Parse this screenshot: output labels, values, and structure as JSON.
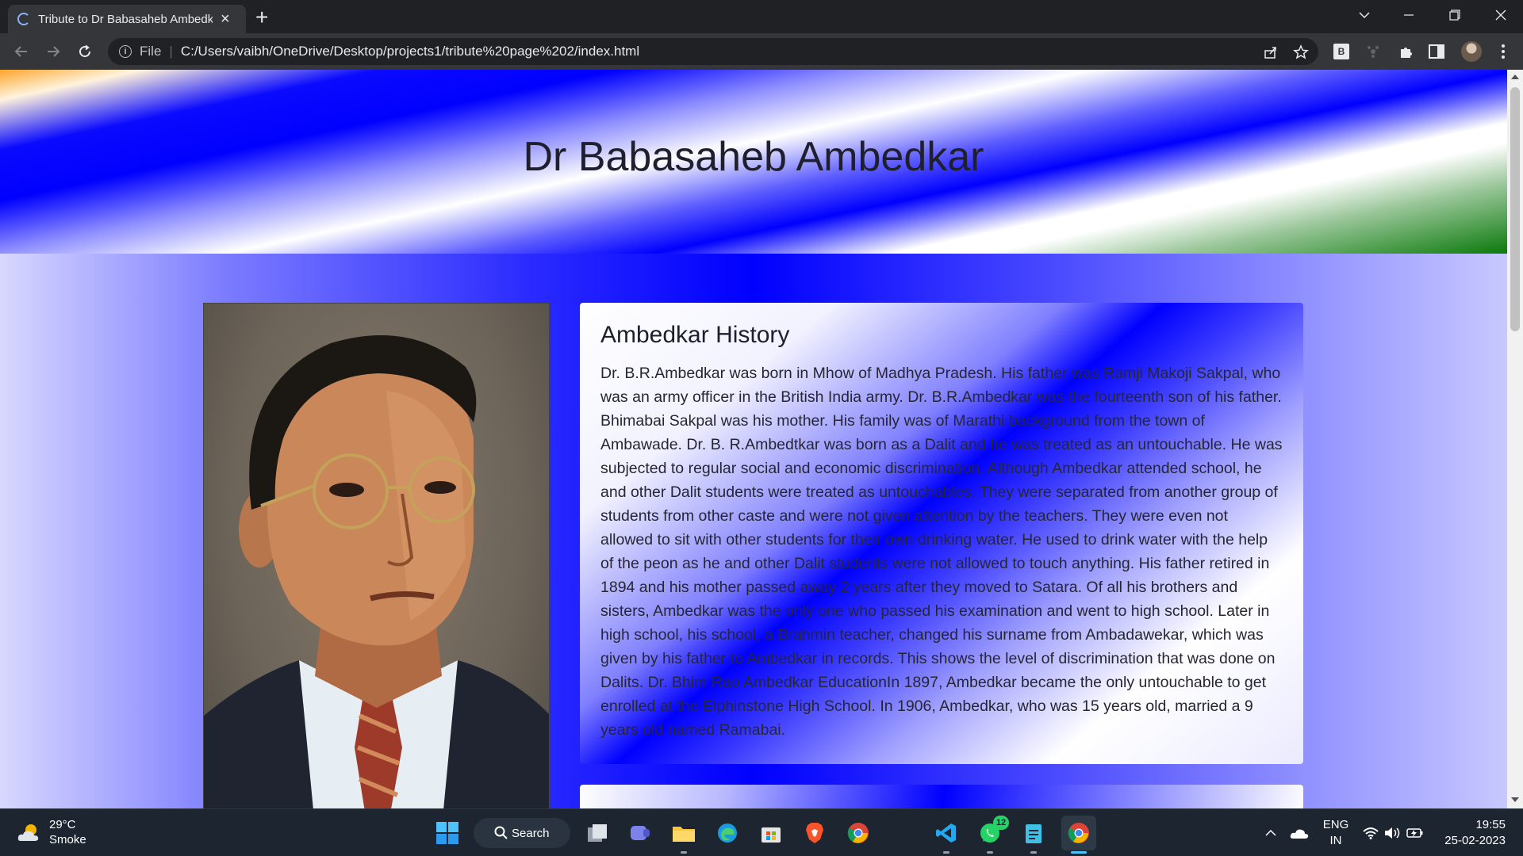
{
  "browser": {
    "tab_title": "Tribute to Dr Babasaheb Ambedk",
    "address_scheme": "File",
    "address_url": "C:/Users/vaibh/OneDrive/Desktop/projects1/tribute%20page%202/index.html",
    "extension_letter": "B"
  },
  "page": {
    "hero_title": "Dr Babasaheb Ambedkar",
    "history": {
      "heading": "Ambedkar History",
      "body": "Dr. B.R.Ambedkar was born in Mhow of Madhya Pradesh. His father was Ramji Makoji Sakpal, who was an army officer in the British India army. Dr. B.R.Ambedkar was the fourteenth son of his father. Bhimabai Sakpal was his mother. His family was of Marathi background from the town of Ambawade. Dr. B. R.Ambedtkar was born as a Dalit and he was treated as an untouchable. He was subjected to regular social and economic discrimination. Although Ambedkar attended school, he and other Dalit students were treated as untouchables. They were separated from another group of students from other caste and were not given attention by the teachers. They were even not allowed to sit with other students for their own drinking water. He used to drink water with the help of the peon as he and other Dalit students were not allowed to touch anything. His father retired in 1894 and his mother passed away 2 years after they moved to Satara. Of all his brothers and sisters, Ambedkar was the only one who passed his examination and went to high school. Later in high school, his school, a Brahmin teacher, changed his surname from Ambadawekar, which was given by his father to Ambedkar in records. This shows the level of discrimination that was done on Dalits. Dr. Bhim Rao Ambedkar EducationIn 1897, Ambedkar became the only untouchable to get enrolled at the Elphinstone High School. In 1906, Ambedkar, who was 15 years old, married a 9 years old named Ramabai."
    }
  },
  "taskbar": {
    "weather_temp": "29°C",
    "weather_desc": "Smoke",
    "search_label": "Search",
    "whatsapp_badge": "12",
    "lang_line1": "ENG",
    "lang_line2": "IN",
    "time": "19:55",
    "date": "25-02-2023"
  },
  "colors": {
    "accent": "#0000ff",
    "saffron": "#ffa52a",
    "green": "#0b7a0b"
  }
}
